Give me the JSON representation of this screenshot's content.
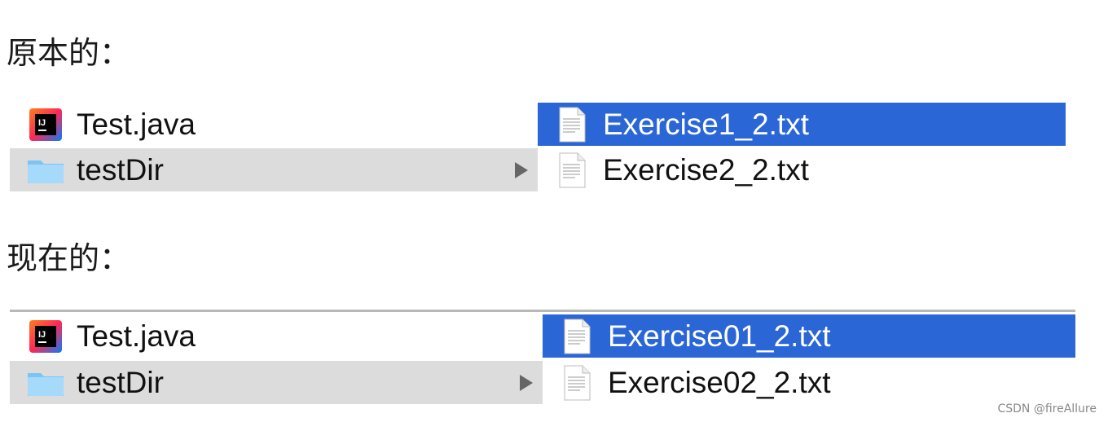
{
  "sections": [
    {
      "heading": "原本的：",
      "left_items": [
        {
          "label": "Test.java",
          "icon": "intellij-java-file-icon"
        },
        {
          "label": "testDir",
          "icon": "folder-icon"
        }
      ],
      "right_items": [
        {
          "label": "Exercise1_2.txt",
          "icon": "text-file-icon"
        },
        {
          "label": "Exercise2_2.txt",
          "icon": "text-file-icon"
        }
      ]
    },
    {
      "heading": "现在的：",
      "left_items": [
        {
          "label": "Test.java",
          "icon": "intellij-java-file-icon"
        },
        {
          "label": "testDir",
          "icon": "folder-icon"
        }
      ],
      "right_items": [
        {
          "label": "Exercise01_2.txt",
          "icon": "text-file-icon"
        },
        {
          "label": "Exercise02_2.txt",
          "icon": "text-file-icon"
        }
      ]
    }
  ],
  "credit": "CSDN @fireAllure",
  "colors": {
    "selected_blue": "#2a66d6",
    "selected_gray": "#dcdcdc",
    "folder_blue": "#8fd0f7"
  }
}
